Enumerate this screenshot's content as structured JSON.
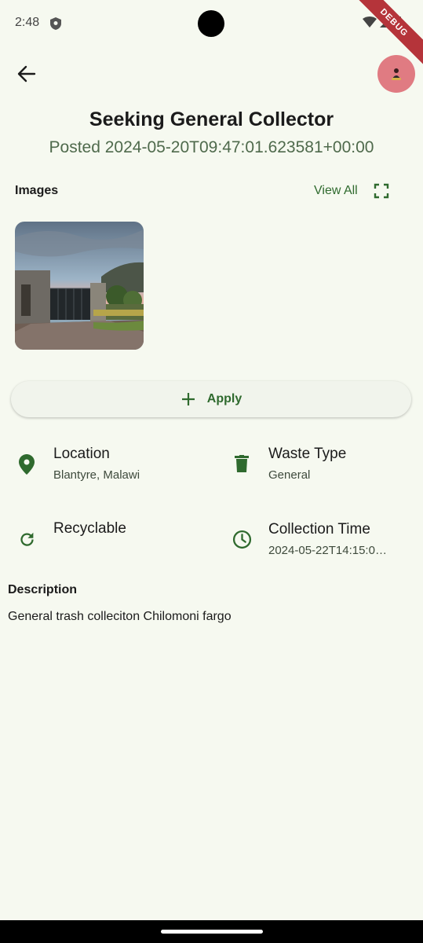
{
  "status": {
    "time": "2:48",
    "debug": "DEBUG"
  },
  "header": {
    "title": "Seeking General Collector",
    "posted_prefix": "Posted",
    "posted_time": "2024-05-20T09:47:01.623581+00:00"
  },
  "images": {
    "label": "Images",
    "view_all": "View All"
  },
  "apply": {
    "label": "Apply"
  },
  "details": {
    "location": {
      "title": "Location",
      "value": "Blantyre, Malawi"
    },
    "waste_type": {
      "title": "Waste Type",
      "value": "General"
    },
    "recyclable": {
      "title": "Recyclable",
      "value": ""
    },
    "collection_time": {
      "title": "Collection Time",
      "value": "2024-05-22T14:15:0…"
    }
  },
  "description": {
    "label": "Description",
    "text": "General trash colleciton Chilomoni fargo"
  },
  "colors": {
    "background": "#f6f9f0",
    "accent": "#2f6a2e",
    "avatar": "#e07b82"
  }
}
